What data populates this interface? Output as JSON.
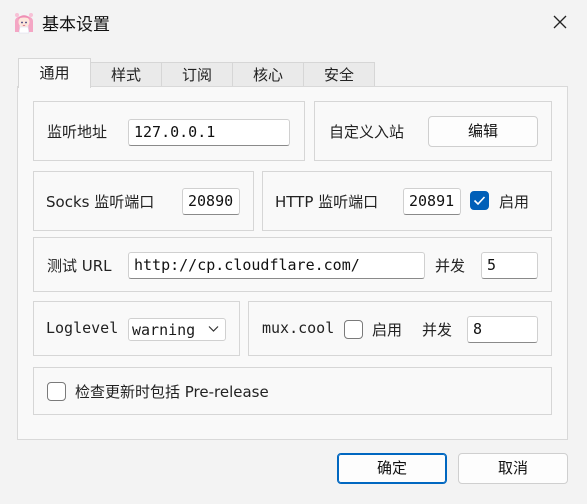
{
  "window": {
    "title": "基本设置",
    "icon": "anime-character-app-icon"
  },
  "tabs": [
    {
      "label": "通用",
      "active": true
    },
    {
      "label": "样式",
      "active": false
    },
    {
      "label": "订阅",
      "active": false
    },
    {
      "label": "核心",
      "active": false
    },
    {
      "label": "安全",
      "active": false
    }
  ],
  "general": {
    "listen_address_label": "监听地址",
    "listen_address_value": "127.0.0.1",
    "custom_inbound_label": "自定义入站",
    "edit_button": "编辑",
    "socks_label": "Socks 监听端口",
    "socks_port": "20890",
    "http_label": "HTTP 监听端口",
    "http_port": "20891",
    "http_enabled_label": "启用",
    "http_enabled": true,
    "test_url_label": "测试 URL",
    "test_url_value": "http://cp.cloudflare.com/",
    "concurrency_label": "并发",
    "concurrency_value": "5",
    "loglevel_label": "Loglevel",
    "loglevel_value": "warning",
    "mux_label": "mux.cool",
    "mux_enabled_label": "启用",
    "mux_enabled": false,
    "mux_concurrency_label": "并发",
    "mux_concurrency_value": "8",
    "prerelease_label": "检查更新时包括 Pre-release",
    "prerelease_checked": false
  },
  "footer": {
    "ok_button": "确定",
    "cancel_button": "取消"
  },
  "colors": {
    "accent": "#005fb8",
    "background": "#f3f3f3",
    "panel": "#f9f9f9"
  }
}
